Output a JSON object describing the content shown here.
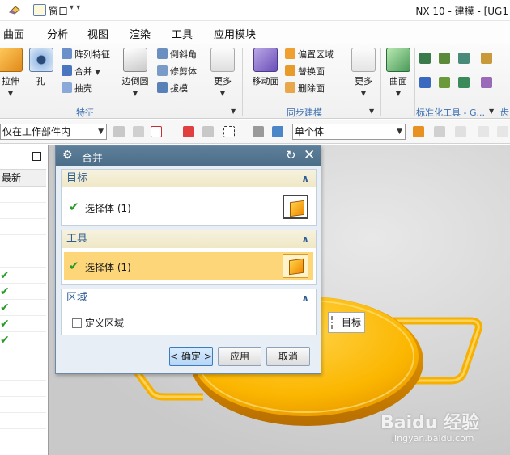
{
  "titlebar": {
    "window_menu": "窗口",
    "title": "NX 10 - 建模 - [UG1"
  },
  "menubar": {
    "items": [
      "曲面",
      "分析",
      "视图",
      "渲染",
      "工具",
      "应用模块"
    ]
  },
  "ribbon": {
    "feature_group": {
      "label": "特征",
      "extrude": "拉伸",
      "hole": "孔",
      "pattern_feature": "阵列特征",
      "unite": "合并",
      "shell": "抽壳",
      "edge_blend": "边倒圆",
      "chamfer": "倒斜角",
      "trim_body": "修剪体",
      "draft": "拔模",
      "more": "更多"
    },
    "sync_group": {
      "label": "同步建模",
      "move_face": "移动面",
      "offset_region": "偏置区域",
      "replace_face": "替换面",
      "delete_face": "删除面",
      "more": "更多"
    },
    "surface_group": {
      "surface": "曲面"
    },
    "standard_group": {
      "label": "标准化工具 - G...",
      "extra": "齿"
    }
  },
  "filterbar": {
    "scope": "仅在工作部件内",
    "body_filter": "单个体"
  },
  "leftpanel": {
    "column_header": "最新",
    "checks": [
      "✔",
      "✔",
      "✔",
      "✔",
      "✔"
    ]
  },
  "dialog": {
    "title": "合并",
    "target_section": {
      "header": "目标",
      "select_label": "选择体 (1)"
    },
    "tool_section": {
      "header": "工具",
      "select_label": "选择体 (1)"
    },
    "region_section": {
      "header": "区域",
      "define_region": "定义区域"
    },
    "buttons": {
      "ok": "< 确定 >",
      "apply": "应用",
      "cancel": "取消"
    }
  },
  "viewport": {
    "target_label": "目标"
  },
  "watermark": {
    "brand": "Baidu 经验",
    "url": "jingyan.baidu.com"
  },
  "colors": {
    "dialog_title": "#4b6d87",
    "section_header": "#2e5d94",
    "selected_row": "#fdd67a",
    "part_yellow": "#f7b500",
    "check_green": "#2a9a2a"
  }
}
